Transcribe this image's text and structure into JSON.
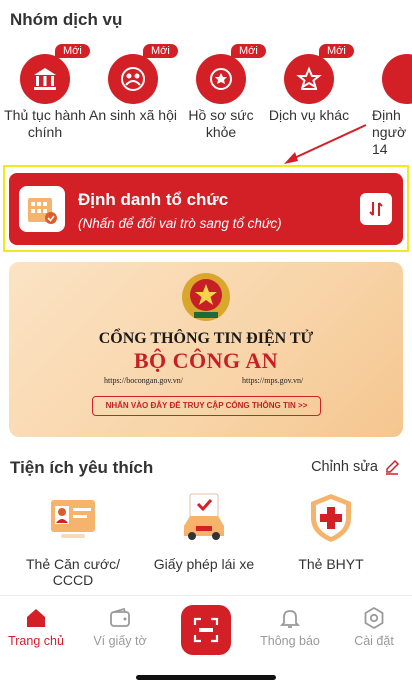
{
  "services": {
    "title": "Nhóm dịch vụ",
    "new_badge": "Mới",
    "items": [
      {
        "label": "Thủ tục hành chính",
        "icon": "bank-icon"
      },
      {
        "label": "An sinh xã hội",
        "icon": "family-icon"
      },
      {
        "label": "Hồ sơ sức khỏe",
        "icon": "health-icon"
      },
      {
        "label": "Dịch vụ khác",
        "icon": "star-icon"
      },
      {
        "label": "Định ngườ 14",
        "icon": "id-icon"
      }
    ]
  },
  "org_card": {
    "title": "Định danh tổ chức",
    "subtitle": "(Nhấn để đổi vai trò sang tổ chức)",
    "swap_icon": "swap-vertical-icon"
  },
  "banner": {
    "line1": "CỔNG THÔNG TIN ĐIỆN TỬ",
    "line2": "BỘ CÔNG AN",
    "url1": "https://bocongan.gov.vn/",
    "url2": "https://mps.gov.vn/",
    "cta": "NHẤN VÀO ĐÂY ĐỂ TRUY CẬP CỔNG THÔNG TIN >>"
  },
  "favorites": {
    "title": "Tiện ích yêu thích",
    "edit_label": "Chỉnh sửa",
    "items": [
      {
        "label": "Thẻ Căn cước/ CCCD",
        "icon": "id-card-icon"
      },
      {
        "label": "Giấy phép lái xe",
        "icon": "car-license-icon"
      },
      {
        "label": "Thẻ BHYT",
        "icon": "health-insurance-icon"
      }
    ]
  },
  "tabbar": {
    "home": "Trang chủ",
    "wallet": "Ví giấy tờ",
    "notify": "Thông báo",
    "settings": "Cài đặt"
  },
  "colors": {
    "primary": "#d32027",
    "highlight": "#f2ea1a"
  }
}
